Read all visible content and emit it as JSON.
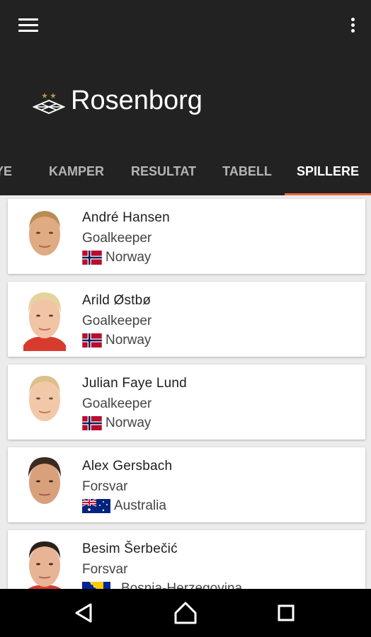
{
  "appbar": {
    "title": "Rosenborg",
    "icons": {
      "menu": "hamburger-menu-icon",
      "more": "overflow-vertical-dots-icon",
      "logo": "rosenborg-crest"
    }
  },
  "tabs": [
    {
      "label": "YE",
      "active": false
    },
    {
      "label": "KAMPER",
      "active": false
    },
    {
      "label": "RESULTAT",
      "active": false
    },
    {
      "label": "TABELL",
      "active": false
    },
    {
      "label": "SPILLERE",
      "active": true
    }
  ],
  "players": [
    {
      "name": "André Hansen",
      "position": "Goalkeeper",
      "country": "Norway",
      "flag": "norway-flag"
    },
    {
      "name": "Arild Østbø",
      "position": "Goalkeeper",
      "country": "Norway",
      "flag": "norway-flag"
    },
    {
      "name": "Julian Faye Lund",
      "position": "Goalkeeper",
      "country": "Norway",
      "flag": "norway-flag"
    },
    {
      "name": "Alex Gersbach",
      "position": "Forsvar",
      "country": "Australia",
      "flag": "australia-flag"
    },
    {
      "name": "Besim Šerbečić",
      "position": "Forsvar",
      "country": "Bosnia-Herzegovina",
      "flag": "bosnia-flag"
    }
  ],
  "navbar": {
    "back": "back-triangle-icon",
    "home": "home-icon",
    "recents": "recents-square-icon"
  },
  "colors": {
    "appbar": "#222222",
    "tab_indicator": "#e8693d",
    "background": "#ececec"
  }
}
